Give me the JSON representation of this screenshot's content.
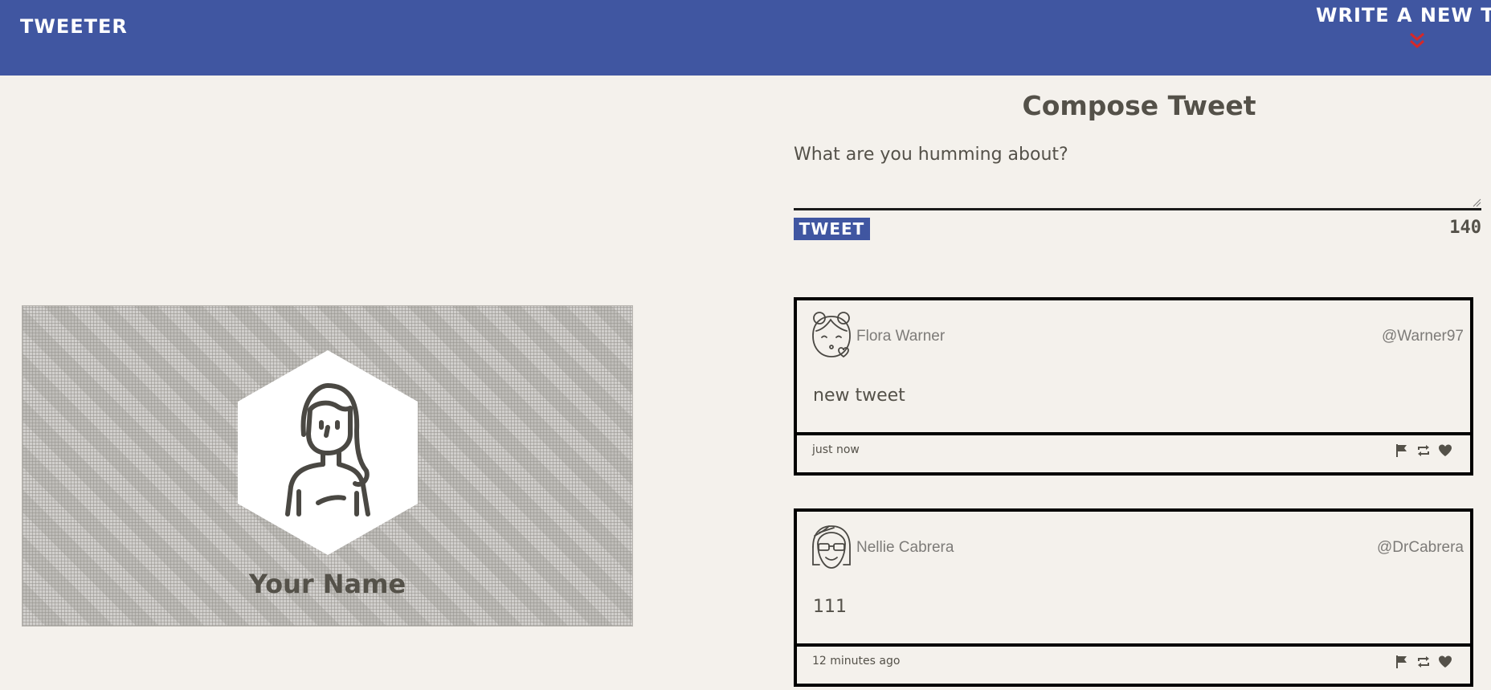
{
  "nav": {
    "brand": "Tweeter",
    "write_new": "Write a new tweet"
  },
  "profile": {
    "name": "Your Name",
    "avatar_icon": "woman-avatar-icon"
  },
  "compose": {
    "title": "Compose Tweet",
    "placeholder": "What are you humming about?",
    "button_label": "Tweet",
    "counter": "140"
  },
  "tweets": [
    {
      "author": "Flora Warner",
      "handle": "@Warner97",
      "body": "new tweet",
      "time": "just now",
      "avatar_icon": "girl-kiss-avatar-icon"
    },
    {
      "author": "Nellie Cabrera",
      "handle": "@DrCabrera",
      "body": "111",
      "time": "12 minutes ago",
      "avatar_icon": "girl-sunglasses-avatar-icon"
    }
  ],
  "colors": {
    "nav_bg": "#4056a1",
    "page_bg": "#f4f1ec",
    "text": "#545149",
    "accent_red": "#d62828"
  }
}
